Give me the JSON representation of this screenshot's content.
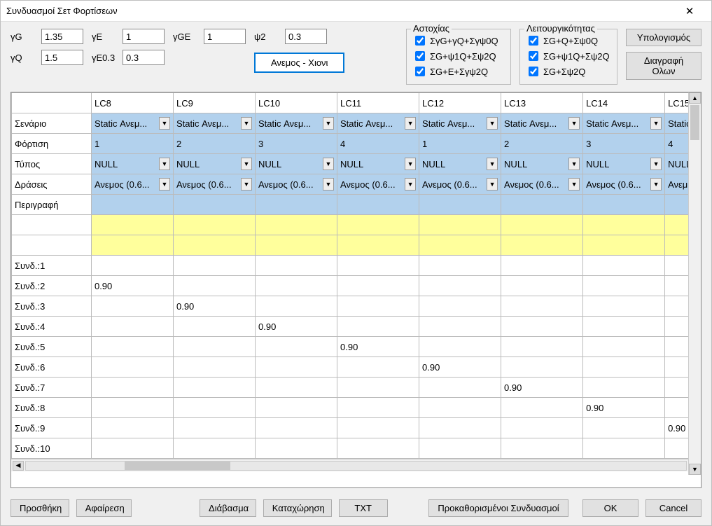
{
  "title": "Συνδυασμοί Σετ Φορτίσεων",
  "params": {
    "gG_label": "γG",
    "gG": "1.35",
    "gQ_label": "γQ",
    "gQ": "1.5",
    "gE_label": "γE",
    "gE": "1",
    "gE03_label": "γE0.3",
    "gE03": "0.3",
    "gGE_label": "γGE",
    "gGE": "1",
    "psi2_label": "ψ2",
    "psi2": "0.3"
  },
  "wind_snow_btn": "Ανεμος - Χιονι",
  "failure": {
    "legend": "Αστοχίας",
    "c1": "ΣγG+γQ+Σγψ0Q",
    "c2": "ΣG+ψ1Q+Σψ2Q",
    "c3": "ΣG+E+Σγψ2Q"
  },
  "serviceability": {
    "legend": "Λειτουργικότητας",
    "c1": "ΣG+Q+Σψ0Q",
    "c2": "ΣG+ψ1Q+Σψ2Q",
    "c3": "ΣG+Σψ2Q"
  },
  "right_buttons": {
    "calc": "Υπολογισμός",
    "delete_all": "Διαγραφή Ολων"
  },
  "columns": [
    "LC8",
    "LC9",
    "LC10",
    "LC11",
    "LC12",
    "LC13",
    "LC14",
    "LC15"
  ],
  "rowheads": {
    "scenario": "Σενάριο",
    "load": "Φόρτιση",
    "type": "Τύπος",
    "actions": "Δράσεις",
    "description": "Περιγραφή",
    "synd1": "Συνδ.:1",
    "synd2": "Συνδ.:2",
    "synd3": "Συνδ.:3",
    "synd4": "Συνδ.:4",
    "synd5": "Συνδ.:5",
    "synd6": "Συνδ.:6",
    "synd7": "Συνδ.:7",
    "synd8": "Συνδ.:8",
    "synd9": "Συνδ.:9",
    "synd10": "Συνδ.:10"
  },
  "scenario_text": "Static Ανεμ...",
  "scenario_partial": "Static",
  "load_row": [
    "1",
    "2",
    "3",
    "4",
    "1",
    "2",
    "3",
    "4"
  ],
  "type_text": "NULL",
  "action_text": "Ανεμος (0.6...",
  "action_partial": "Ανεμ",
  "val090": "0.90",
  "bottom": {
    "add": "Προσθήκη",
    "remove": "Αφαίρεση",
    "read": "Διάβασμα",
    "save": "Καταχώρηση",
    "txt": "TXT",
    "defaults": "Προκαθορισμένοι Συνδυασμοί",
    "ok": "OK",
    "cancel": "Cancel"
  },
  "chart_data": {
    "type": "table",
    "columns": [
      "",
      "LC8",
      "LC9",
      "LC10",
      "LC11",
      "LC12",
      "LC13",
      "LC14",
      "LC15"
    ],
    "rows": [
      [
        "Σενάριο",
        "Static Ανεμ...",
        "Static Ανεμ...",
        "Static Ανεμ...",
        "Static Ανεμ...",
        "Static Ανεμ...",
        "Static Ανεμ...",
        "Static Ανεμ...",
        "Static"
      ],
      [
        "Φόρτιση",
        "1",
        "2",
        "3",
        "4",
        "1",
        "2",
        "3",
        "4"
      ],
      [
        "Τύπος",
        "NULL",
        "NULL",
        "NULL",
        "NULL",
        "NULL",
        "NULL",
        "NULL",
        "NULL"
      ],
      [
        "Δράσεις",
        "Ανεμος (0.6...",
        "Ανεμος (0.6...",
        "Ανεμος (0.6...",
        "Ανεμος (0.6...",
        "Ανεμος (0.6...",
        "Ανεμος (0.6...",
        "Ανεμος (0.6...",
        "Ανεμ"
      ],
      [
        "Περιγραφή",
        "",
        "",
        "",
        "",
        "",
        "",
        "",
        ""
      ],
      [
        "Συνδ.:1",
        "",
        "",
        "",
        "",
        "",
        "",
        "",
        ""
      ],
      [
        "Συνδ.:2",
        "0.90",
        "",
        "",
        "",
        "",
        "",
        "",
        ""
      ],
      [
        "Συνδ.:3",
        "",
        "0.90",
        "",
        "",
        "",
        "",
        "",
        ""
      ],
      [
        "Συνδ.:4",
        "",
        "",
        "0.90",
        "",
        "",
        "",
        "",
        ""
      ],
      [
        "Συνδ.:5",
        "",
        "",
        "",
        "0.90",
        "",
        "",
        "",
        ""
      ],
      [
        "Συνδ.:6",
        "",
        "",
        "",
        "",
        "0.90",
        "",
        "",
        ""
      ],
      [
        "Συνδ.:7",
        "",
        "",
        "",
        "",
        "",
        "0.90",
        "",
        ""
      ],
      [
        "Συνδ.:8",
        "",
        "",
        "",
        "",
        "",
        "",
        "0.90",
        ""
      ],
      [
        "Συνδ.:9",
        "",
        "",
        "",
        "",
        "",
        "",
        "",
        "0.90"
      ],
      [
        "Συνδ.:10",
        "",
        "",
        "",
        "",
        "",
        "",
        "",
        ""
      ]
    ]
  }
}
